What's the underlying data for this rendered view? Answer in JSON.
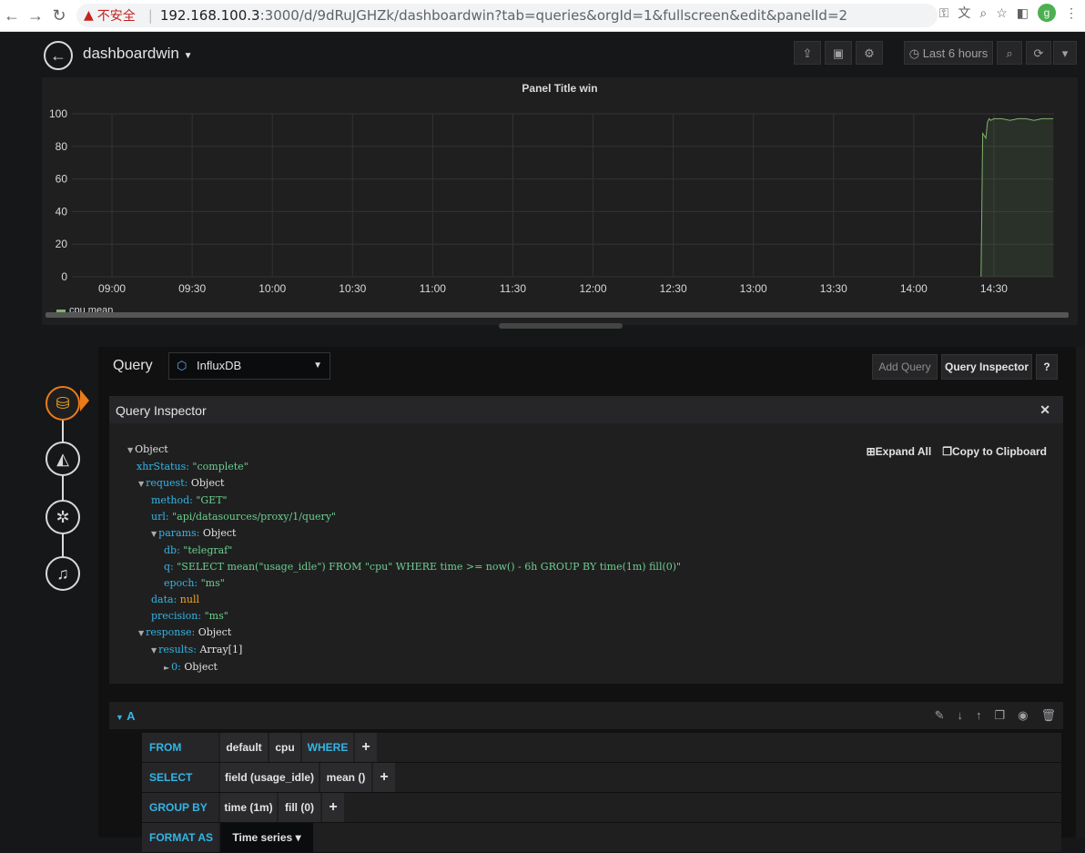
{
  "browser": {
    "warning": "不安全",
    "host": "192.168.100.3",
    "path": ":3000/d/9dRuJGHZk/dashboardwin?tab=queries&orgId=1&fullscreen&edit&panelId=2",
    "profile_initial": "g"
  },
  "topbar": {
    "title": "dashboardwin",
    "time_range": "Last 6 hours"
  },
  "panel": {
    "legend": "cpu mean"
  },
  "chart_data": {
    "type": "line",
    "title": "Panel Title win",
    "xlabel": "",
    "ylabel": "",
    "ylim": [
      0,
      100
    ],
    "yticks": [
      "0",
      "20",
      "40",
      "60",
      "80",
      "100"
    ],
    "xticks": [
      "09:00",
      "09:30",
      "10:00",
      "10:30",
      "11:00",
      "11:30",
      "12:00",
      "12:30",
      "13:00",
      "13:30",
      "14:00",
      "14:30"
    ],
    "x_range_hours": [
      8.75,
      14.875
    ],
    "grid": true,
    "legend_position": "bottom-left",
    "series": [
      {
        "name": "cpu mean",
        "color": "#7eb26d",
        "x_hours": [
          14.42,
          14.43,
          14.45,
          14.46,
          14.47,
          14.48,
          14.5,
          14.55,
          14.6,
          14.65,
          14.7,
          14.75,
          14.8,
          14.85,
          14.87
        ],
        "values": [
          0,
          88,
          85,
          95,
          97,
          96,
          97,
          97,
          96,
          97,
          97,
          96,
          97,
          97,
          97
        ]
      }
    ]
  },
  "editor": {
    "query_label": "Query",
    "datasource": "InfluxDB",
    "add_query": "Add Query",
    "query_inspector": "Query Inspector",
    "help": "?"
  },
  "inspector": {
    "title": "Query Inspector",
    "expand_all": "Expand All",
    "copy_clipboard": "Copy to Clipboard",
    "root": "Object",
    "xhrStatus_key": "xhrStatus:",
    "xhrStatus_val": "\"complete\"",
    "request_key": "request:",
    "request_val": "Object",
    "method_key": "method:",
    "method_val": "\"GET\"",
    "url_key": "url:",
    "url_val": "\"api/datasources/proxy/1/query\"",
    "params_key": "params:",
    "params_val": "Object",
    "db_key": "db:",
    "db_val": "\"telegraf\"",
    "q_key": "q:",
    "q_val": "\"SELECT mean(\"usage_idle\") FROM \"cpu\" WHERE time >= now() - 6h GROUP BY time(1m) fill(0)\"",
    "epoch_key": "epoch:",
    "epoch_val": "\"ms\"",
    "data_key": "data:",
    "data_val": "null",
    "precision_key": "precision:",
    "precision_val": "\"ms\"",
    "response_key": "response:",
    "response_val": "Object",
    "results_key": "results:",
    "results_val": "Array[1]",
    "item_key": "0:",
    "item_val": "Object"
  },
  "query_a": {
    "name": "A",
    "from_label": "FROM",
    "from_policy": "default",
    "from_measurement": "cpu",
    "where_label": "WHERE",
    "select_label": "SELECT",
    "select_field": "field (usage_idle)",
    "select_fn": "mean ()",
    "group_label": "GROUP BY",
    "group_time": "time (1m)",
    "group_fill": "fill (0)",
    "format_label": "FORMAT AS",
    "format_value": "Time series",
    "plus": "+"
  }
}
